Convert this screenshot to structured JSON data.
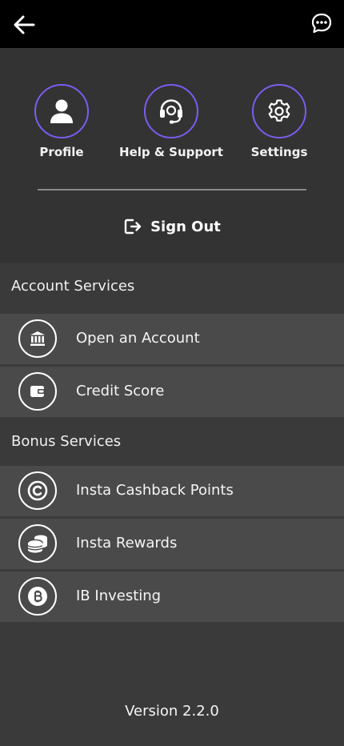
{
  "topbar": {
    "back_icon": "arrow-left-icon",
    "chat_icon": "chat-bubble-icon"
  },
  "quick_actions": [
    {
      "label": "Profile",
      "icon": "person-icon"
    },
    {
      "label": "Help & Support",
      "icon": "headset-icon"
    },
    {
      "label": "Settings",
      "icon": "gear-icon"
    }
  ],
  "sign_out": {
    "label": "Sign Out",
    "icon": "logout-icon"
  },
  "sections": {
    "account": {
      "title": "Account Services",
      "items": [
        {
          "label": "Open an Account",
          "icon": "bank-icon"
        },
        {
          "label": "Credit Score",
          "icon": "wallet-icon"
        }
      ]
    },
    "bonus": {
      "title": "Bonus Services",
      "items": [
        {
          "label": "Insta Cashback Points",
          "icon": "copyright-coin-icon"
        },
        {
          "label": "Insta Rewards",
          "icon": "coin-stack-icon"
        },
        {
          "label": "IB Investing",
          "icon": "bitcoin-icon"
        }
      ]
    }
  },
  "version": "Version 2.2.0",
  "colors": {
    "accent": "#7c5cf0",
    "topbar": "#000000",
    "background": "#3a3a3a"
  }
}
